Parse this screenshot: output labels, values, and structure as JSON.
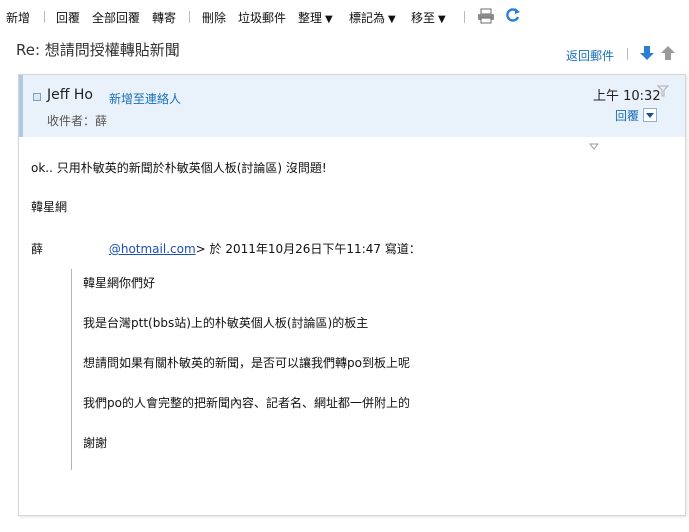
{
  "toolbar": {
    "new": "新增",
    "reply": "回覆",
    "reply_all": "全部回覆",
    "forward": "轉寄",
    "delete": "刪除",
    "junk": "垃圾郵件",
    "organize": "整理",
    "mark": "標記為",
    "move_to": "移至",
    "caret": "▼"
  },
  "message": {
    "subject": "Re: 想請問授權轉貼新聞",
    "back_to_messages": "返回郵件",
    "sender_name": "Jeff Ho",
    "add_contact": "新增至連絡人",
    "recipient": "收件者：薛",
    "time": "上午 10:32",
    "reply_label": "回覆"
  },
  "body": {
    "line1": "ok.. 只用朴敏英的新聞於朴敏英個人板(討論區) 沒問題!",
    "line2": "韓星網",
    "quote_sender": "薛",
    "quote_email": "@hotmail.com",
    "quote_header_rest": "> 於 2011年10月26日下午11:47 寫道：",
    "quoted": [
      "韓星網你們好",
      "我是台灣ptt(bbs站)上的朴敏英個人板(討論區)的板主",
      "想請問如果有關朴敏英的新聞，是否可以讓我們轉po到板上呢",
      "我們po的人會完整的把新聞內容、記者名、網址都一併附上的",
      "謝謝"
    ]
  },
  "colors": {
    "link": "#1a6fb8",
    "header_bg": "#e9f1fa"
  },
  "icons": [
    "print-icon",
    "refresh-icon",
    "arrow-down-icon",
    "arrow-up-icon",
    "flag-icon"
  ]
}
